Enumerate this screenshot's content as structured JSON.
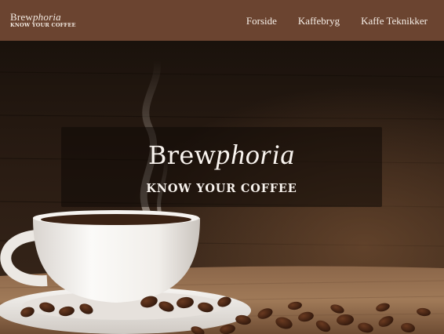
{
  "brand": {
    "name_part1": "Brew",
    "name_part2": "phoria",
    "tagline": "KNOW YOUR COFFEE"
  },
  "nav": {
    "links": [
      {
        "label": "Forside"
      },
      {
        "label": "Kaffebryg"
      },
      {
        "label": "Kaffe Teknikker"
      }
    ]
  },
  "hero": {
    "title_part1": "Brew",
    "title_part2": "phoria",
    "subtitle": "KNOW YOUR COFFEE",
    "image": "coffee-cup-with-steam-and-beans-photo"
  },
  "colors": {
    "navbar": "#6b4430",
    "nav_text": "#f6efe8",
    "banner_overlay": "#0e0906",
    "hero_text": "#f8f3ee"
  }
}
